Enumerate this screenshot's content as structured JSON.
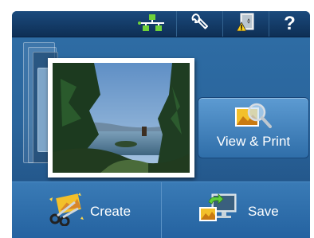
{
  "status_bar": {
    "network_icon": "network-status-icon",
    "setup_icon": "wrench-icon",
    "ink_icon": "ink-levels-warning-icon",
    "help_label": "?"
  },
  "photo_viewer": {
    "current_photo": "lake-landscape-thumbnail"
  },
  "view_print": {
    "label": "View & Print",
    "icon": "photo-magnifier-icon"
  },
  "actions": {
    "create": {
      "label": "Create",
      "icon": "scissors-create-icon"
    },
    "save": {
      "label": "Save",
      "icon": "save-to-computer-icon"
    }
  },
  "colors": {
    "background": "#2a659c",
    "topbar": "#12375f",
    "button": "#3e82c0",
    "network_green": "#6fd23a",
    "text": "#ffffff"
  }
}
